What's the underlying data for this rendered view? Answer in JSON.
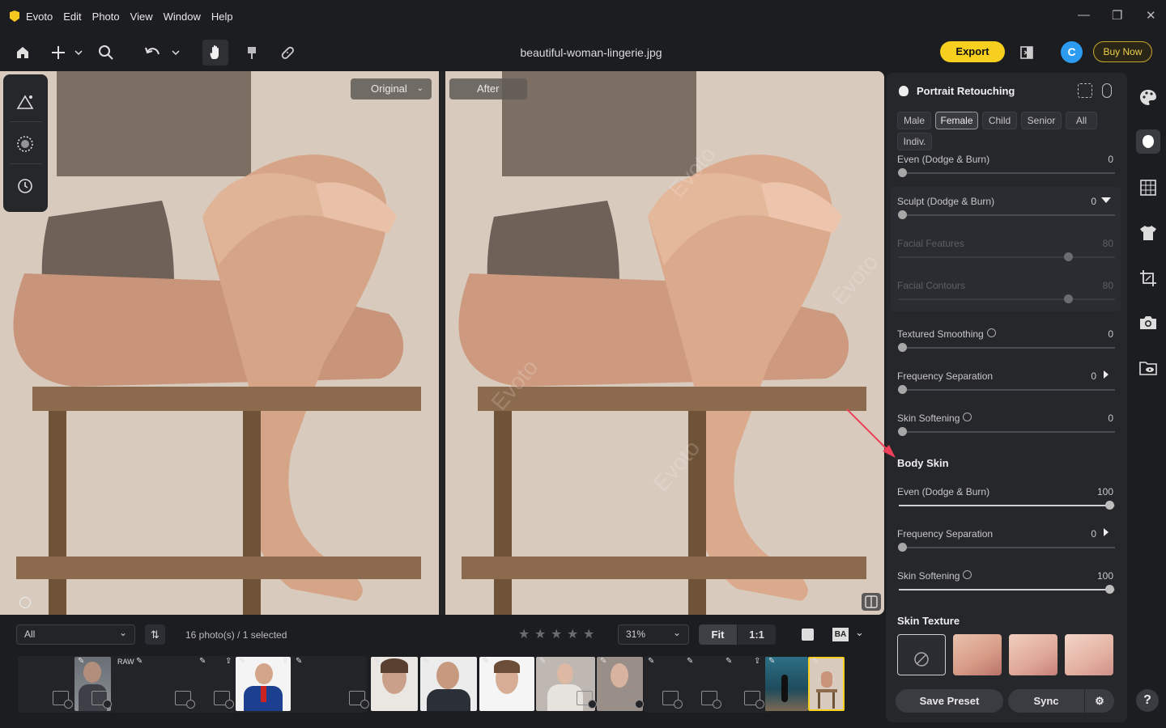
{
  "app": {
    "name": "Evoto",
    "accent": "#f6cf1f"
  },
  "menu": [
    "Edit",
    "Photo",
    "View",
    "Window",
    "Help"
  ],
  "toolbar": {
    "filename": "beautiful-woman-lingerie.jpg",
    "export_label": "Export",
    "avatar_letter": "C",
    "buy_label": "Buy Now"
  },
  "canvas": {
    "original_label": "Original",
    "after_label": "After",
    "watermark": "Evoto"
  },
  "panel": {
    "title": "Portrait Retouching",
    "chips": [
      "Male",
      "Female",
      "Child",
      "Senior",
      "All",
      "Indiv."
    ],
    "selected_chip": "Female",
    "sliders_face": [
      {
        "label": "Even (Dodge & Burn)",
        "value": "0"
      },
      {
        "label": "Sculpt (Dodge & Burn)",
        "value": "0"
      },
      {
        "label": "Facial Features",
        "value": "80"
      },
      {
        "label": "Facial Contours",
        "value": "80"
      },
      {
        "label": "Textured Smoothing",
        "value": "0"
      },
      {
        "label": "Frequency Separation",
        "value": "0"
      },
      {
        "label": "Skin Softening",
        "value": "0"
      }
    ],
    "body_skin_title": "Body Skin",
    "sliders_body": [
      {
        "label": "Even (Dodge & Burn)",
        "value": "100"
      },
      {
        "label": "Frequency Separation",
        "value": "0"
      },
      {
        "label": "Skin Softening",
        "value": "100"
      }
    ],
    "skin_texture_title": "Skin Texture",
    "save_preset_label": "Save Preset",
    "sync_label": "Sync"
  },
  "filmstrip": {
    "filter_value": "All",
    "count_text": "16 photo(s) / 1 selected",
    "zoom_value": "31%",
    "fit_label": "Fit",
    "one_to_one_label": "1:1",
    "raw_badge": "RAW",
    "ba_badge": "BA"
  }
}
